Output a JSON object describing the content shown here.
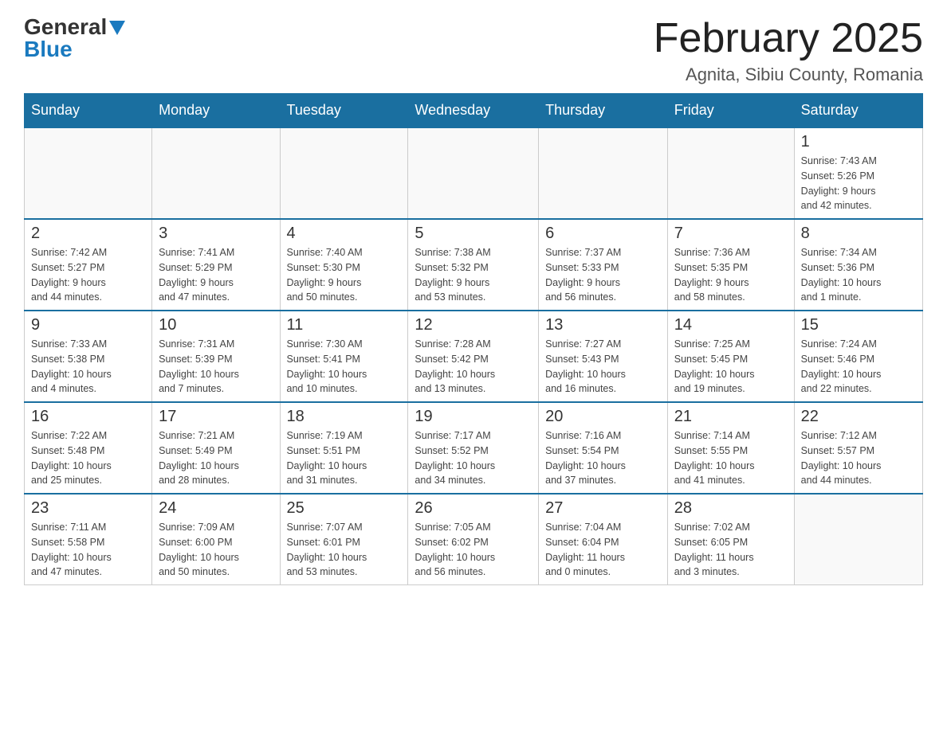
{
  "logo": {
    "general": "General",
    "blue": "Blue",
    "alt": "GeneralBlue logo"
  },
  "title": "February 2025",
  "subtitle": "Agnita, Sibiu County, Romania",
  "headers": [
    "Sunday",
    "Monday",
    "Tuesday",
    "Wednesday",
    "Thursday",
    "Friday",
    "Saturday"
  ],
  "weeks": [
    [
      {
        "day": "",
        "info": ""
      },
      {
        "day": "",
        "info": ""
      },
      {
        "day": "",
        "info": ""
      },
      {
        "day": "",
        "info": ""
      },
      {
        "day": "",
        "info": ""
      },
      {
        "day": "",
        "info": ""
      },
      {
        "day": "1",
        "info": "Sunrise: 7:43 AM\nSunset: 5:26 PM\nDaylight: 9 hours\nand 42 minutes."
      }
    ],
    [
      {
        "day": "2",
        "info": "Sunrise: 7:42 AM\nSunset: 5:27 PM\nDaylight: 9 hours\nand 44 minutes."
      },
      {
        "day": "3",
        "info": "Sunrise: 7:41 AM\nSunset: 5:29 PM\nDaylight: 9 hours\nand 47 minutes."
      },
      {
        "day": "4",
        "info": "Sunrise: 7:40 AM\nSunset: 5:30 PM\nDaylight: 9 hours\nand 50 minutes."
      },
      {
        "day": "5",
        "info": "Sunrise: 7:38 AM\nSunset: 5:32 PM\nDaylight: 9 hours\nand 53 minutes."
      },
      {
        "day": "6",
        "info": "Sunrise: 7:37 AM\nSunset: 5:33 PM\nDaylight: 9 hours\nand 56 minutes."
      },
      {
        "day": "7",
        "info": "Sunrise: 7:36 AM\nSunset: 5:35 PM\nDaylight: 9 hours\nand 58 minutes."
      },
      {
        "day": "8",
        "info": "Sunrise: 7:34 AM\nSunset: 5:36 PM\nDaylight: 10 hours\nand 1 minute."
      }
    ],
    [
      {
        "day": "9",
        "info": "Sunrise: 7:33 AM\nSunset: 5:38 PM\nDaylight: 10 hours\nand 4 minutes."
      },
      {
        "day": "10",
        "info": "Sunrise: 7:31 AM\nSunset: 5:39 PM\nDaylight: 10 hours\nand 7 minutes."
      },
      {
        "day": "11",
        "info": "Sunrise: 7:30 AM\nSunset: 5:41 PM\nDaylight: 10 hours\nand 10 minutes."
      },
      {
        "day": "12",
        "info": "Sunrise: 7:28 AM\nSunset: 5:42 PM\nDaylight: 10 hours\nand 13 minutes."
      },
      {
        "day": "13",
        "info": "Sunrise: 7:27 AM\nSunset: 5:43 PM\nDaylight: 10 hours\nand 16 minutes."
      },
      {
        "day": "14",
        "info": "Sunrise: 7:25 AM\nSunset: 5:45 PM\nDaylight: 10 hours\nand 19 minutes."
      },
      {
        "day": "15",
        "info": "Sunrise: 7:24 AM\nSunset: 5:46 PM\nDaylight: 10 hours\nand 22 minutes."
      }
    ],
    [
      {
        "day": "16",
        "info": "Sunrise: 7:22 AM\nSunset: 5:48 PM\nDaylight: 10 hours\nand 25 minutes."
      },
      {
        "day": "17",
        "info": "Sunrise: 7:21 AM\nSunset: 5:49 PM\nDaylight: 10 hours\nand 28 minutes."
      },
      {
        "day": "18",
        "info": "Sunrise: 7:19 AM\nSunset: 5:51 PM\nDaylight: 10 hours\nand 31 minutes."
      },
      {
        "day": "19",
        "info": "Sunrise: 7:17 AM\nSunset: 5:52 PM\nDaylight: 10 hours\nand 34 minutes."
      },
      {
        "day": "20",
        "info": "Sunrise: 7:16 AM\nSunset: 5:54 PM\nDaylight: 10 hours\nand 37 minutes."
      },
      {
        "day": "21",
        "info": "Sunrise: 7:14 AM\nSunset: 5:55 PM\nDaylight: 10 hours\nand 41 minutes."
      },
      {
        "day": "22",
        "info": "Sunrise: 7:12 AM\nSunset: 5:57 PM\nDaylight: 10 hours\nand 44 minutes."
      }
    ],
    [
      {
        "day": "23",
        "info": "Sunrise: 7:11 AM\nSunset: 5:58 PM\nDaylight: 10 hours\nand 47 minutes."
      },
      {
        "day": "24",
        "info": "Sunrise: 7:09 AM\nSunset: 6:00 PM\nDaylight: 10 hours\nand 50 minutes."
      },
      {
        "day": "25",
        "info": "Sunrise: 7:07 AM\nSunset: 6:01 PM\nDaylight: 10 hours\nand 53 minutes."
      },
      {
        "day": "26",
        "info": "Sunrise: 7:05 AM\nSunset: 6:02 PM\nDaylight: 10 hours\nand 56 minutes."
      },
      {
        "day": "27",
        "info": "Sunrise: 7:04 AM\nSunset: 6:04 PM\nDaylight: 11 hours\nand 0 minutes."
      },
      {
        "day": "28",
        "info": "Sunrise: 7:02 AM\nSunset: 6:05 PM\nDaylight: 11 hours\nand 3 minutes."
      },
      {
        "day": "",
        "info": ""
      }
    ]
  ]
}
